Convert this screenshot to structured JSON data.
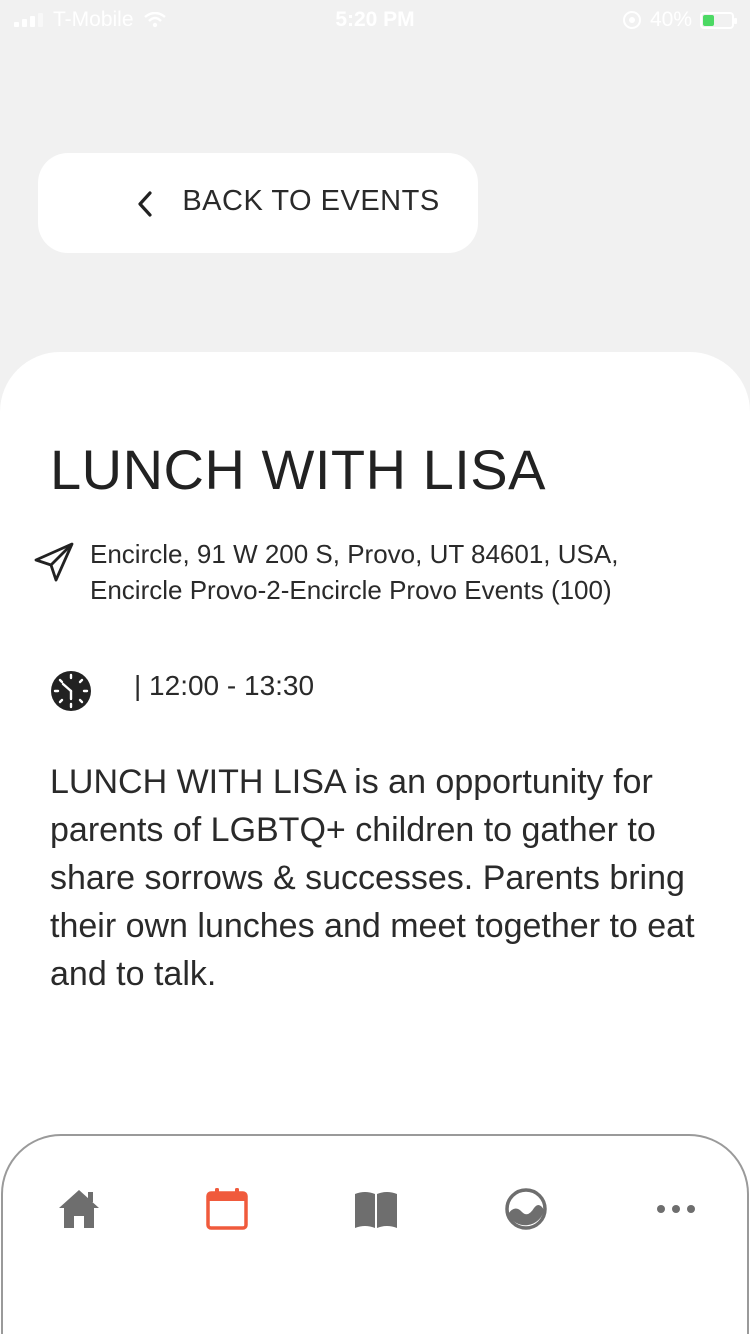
{
  "status_bar": {
    "carrier": "T-Mobile",
    "time": "5:20 PM",
    "battery_percent": "40%",
    "battery_level": 0.4
  },
  "back_button": {
    "label": "BACK TO EVENTS",
    "icon": "chevron-left-icon"
  },
  "event": {
    "title": "LUNCH WITH LISA",
    "location_line1": "Encircle, 91 W 200 S, Provo, UT 84601, USA,",
    "location_line2": "Encircle Provo-2-Encircle Provo Events (100)",
    "time": "| 12:00 - 13:30",
    "description": "LUNCH WITH LISA is an opportunity for parents of LGBTQ+ children to gather to share sorrows & successes. Parents bring their own lunches and meet together to eat and to talk."
  },
  "bottom_nav": {
    "items": [
      {
        "icon": "home-icon",
        "active": false
      },
      {
        "icon": "calendar-icon",
        "active": true
      },
      {
        "icon": "book-icon",
        "active": false
      },
      {
        "icon": "landscape-icon",
        "active": false
      },
      {
        "icon": "more-icon",
        "active": false
      }
    ],
    "active_color": "#f05a3c",
    "inactive_color": "#6e6e6e"
  },
  "colors": {
    "background": "#f1f1f1",
    "card": "#ffffff",
    "text": "#2a2a2a",
    "accent": "#f05a3c"
  }
}
